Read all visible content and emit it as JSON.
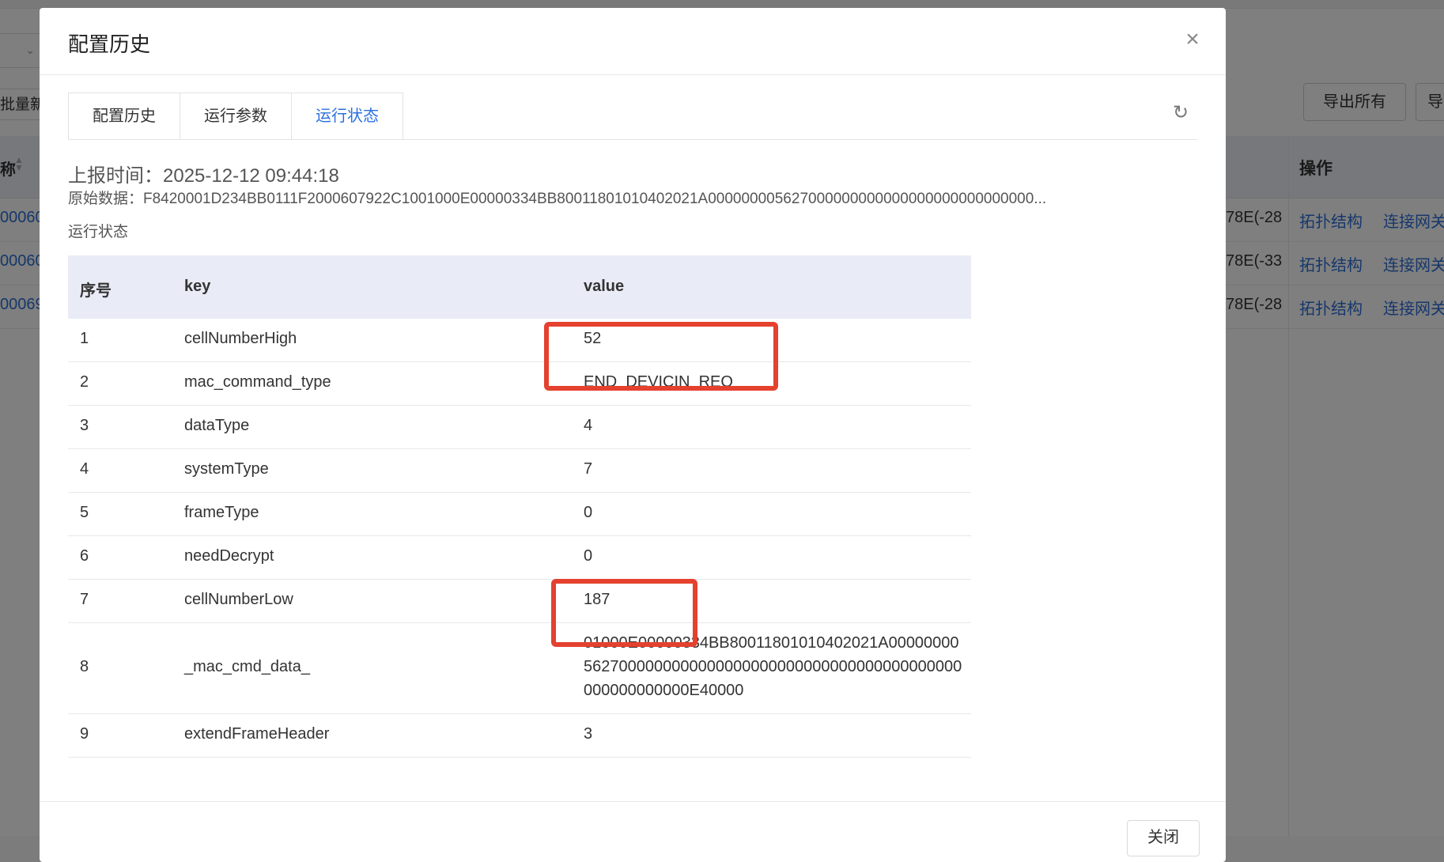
{
  "background": {
    "batch_label": "批量新",
    "export_all_label": "导出所有",
    "export_label": "导",
    "col_name_header": "称",
    "col_op_header": "操作",
    "rows": [
      {
        "id": "00060",
        "mid": "78E(-28",
        "link1": "拓扑结构",
        "link2": "连接网关"
      },
      {
        "id": "00060",
        "mid": "78E(-33",
        "link1": "拓扑结构",
        "link2": "连接网关"
      },
      {
        "id": "00069",
        "mid": "78E(-28",
        "link1": "拓扑结构",
        "link2": "连接网关"
      }
    ]
  },
  "modal": {
    "title": "配置历史",
    "close_icon": "close-icon",
    "tabs": [
      {
        "label": "配置历史",
        "active": false
      },
      {
        "label": "运行参数",
        "active": false
      },
      {
        "label": "运行状态",
        "active": true
      }
    ],
    "refresh_icon": "refresh-icon",
    "report_time": "上报时间：2025-12-12 09:44:18",
    "raw_data": "原始数据：F8420001D234BB0111F2000607922C1001000E00000334BB80011801010402021A000000005627000000000000000000000000000...",
    "section_label": "运行状态",
    "table": {
      "headers": {
        "idx": "序号",
        "key": "key",
        "value": "value"
      },
      "rows": [
        {
          "idx": "1",
          "key": "cellNumberHigh",
          "value": "52"
        },
        {
          "idx": "2",
          "key": "mac_command_type",
          "value": "END_DEVICIN_REQ"
        },
        {
          "idx": "3",
          "key": "dataType",
          "value": "4"
        },
        {
          "idx": "4",
          "key": "systemType",
          "value": "7"
        },
        {
          "idx": "5",
          "key": "frameType",
          "value": "0"
        },
        {
          "idx": "6",
          "key": "needDecrypt",
          "value": "0"
        },
        {
          "idx": "7",
          "key": "cellNumberLow",
          "value": "187"
        },
        {
          "idx": "8",
          "key": "_mac_cmd_data_",
          "value": "01000E00000334BB80011801010402021A000000005627000000000000000000000000000000000000000000000000000E40000"
        },
        {
          "idx": "9",
          "key": "extendFrameHeader",
          "value": "3"
        }
      ]
    },
    "close_button": "关闭"
  },
  "colors": {
    "accent": "#2b6fe0",
    "highlight_box": "#e4412f",
    "table_header_bg": "#e9ecf7"
  }
}
